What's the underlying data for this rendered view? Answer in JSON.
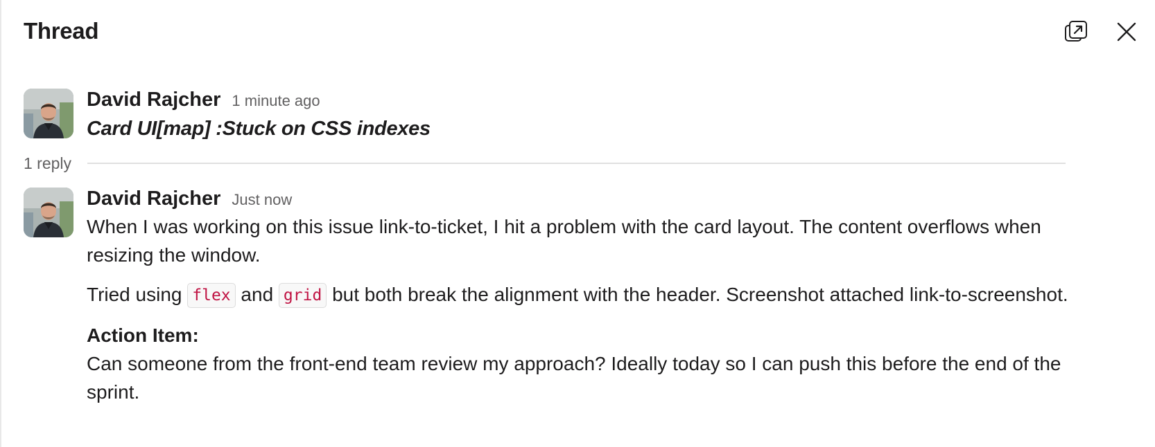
{
  "header": {
    "title": "Thread",
    "popout_icon": "popout-window-icon",
    "close_icon": "close-icon"
  },
  "parent_message": {
    "author": "David Rajcher",
    "timestamp": "1 minute ago",
    "subject": "Card UI[map] :Stuck on CSS indexes"
  },
  "replies": {
    "count_label": "1 reply"
  },
  "reply_message": {
    "author": "David Rajcher",
    "timestamp": "Just now",
    "paragraph1": "When I was working on this issue link-to-ticket, I hit a problem with the card layout. The content overflows when resizing the window.",
    "paragraph2_prefix": "Tried using ",
    "code1": "flex",
    "paragraph2_mid": " and ",
    "code2": "grid",
    "paragraph2_suffix": " but both break the alignment with the header. Screenshot attached link-to-screenshot.",
    "action_heading": "Action Item:",
    "action_text": "Can someone from the front-end team review my approach? Ideally today so I can push this before the end of the sprint."
  },
  "colors": {
    "text": "#1d1c1d",
    "muted": "#616061",
    "code": "#c01343",
    "divider": "#e0e0e0"
  }
}
